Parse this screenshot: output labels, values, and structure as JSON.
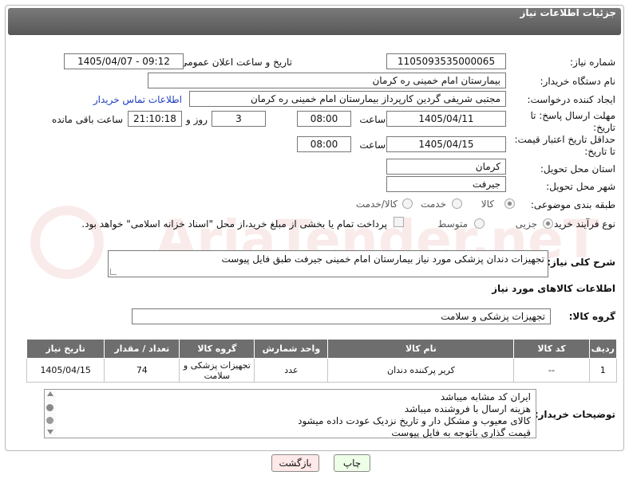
{
  "header": {
    "title": "جزئیات اطلاعات نیاز"
  },
  "form": {
    "need_number_label": "شماره نیاز:",
    "need_number": "1105093535000065",
    "announce_label": "تاریخ و ساعت اعلان عمومی:",
    "announce_value": "1405/04/07 - 09:12",
    "buyer_org_label": "نام دستگاه خریدار:",
    "buyer_org": "بیمارستان امام خمینی  ره  کرمان",
    "creator_label": "ایجاد کننده درخواست:",
    "creator": "مجتبی شریفی گردین کارپرداز بیمارستان امام خمینی  ره  کرمان",
    "contact_link": "اطلاعات تماس خریدار",
    "deadline_label_1": "مهلت ارسال پاسخ: تا",
    "deadline_label_2": "تاریخ:",
    "deadline_date": "1405/04/11",
    "time_label": "ساعت",
    "deadline_time": "08:00",
    "days_value": "3",
    "days_label": "روز و",
    "remaining_time": "21:10:18",
    "remaining_label": "ساعت باقی مانده",
    "validity_label_1": "حداقل تاریخ اعتبار قیمت:",
    "validity_label_2": "تا تاریخ:",
    "validity_date": "1405/04/15",
    "validity_time": "08:00",
    "province_label": "استان محل تحویل:",
    "province": "کرمان",
    "city_label": "شهر محل تحویل:",
    "city": "جیرفت",
    "category_label": "طبقه بندی موضوعی:",
    "category_options": [
      "کالا",
      "خدمت",
      "کالا/خدمت"
    ],
    "process_label": "نوع فرآیند خرید :",
    "process_options": [
      "جزیی",
      "متوسط"
    ],
    "payment_note": "پرداخت تمام یا بخشی از مبلغ خرید،از محل \"اسناد خزانه اسلامی\" خواهد بود.",
    "description_label": "شرح کلی نیاز:",
    "description": "تجهیزات دندان پزشکی مورد نیاز بیمارستان  امام خمینی جیرفت طبق فایل پیوست"
  },
  "goods": {
    "section_title": "اطلاعات کالاهای مورد نیاز",
    "group_label": "گروه کالا:",
    "group_value": "تجهیزات پزشکی و سلامت",
    "columns": [
      "ردیف",
      "کد کالا",
      "نام کالا",
      "واحد شمارش",
      "گروه کالا",
      "تعداد / مقدار",
      "تاریخ نیاز"
    ],
    "rows": [
      {
        "row": "1",
        "code": "--",
        "name": "کریر پرکننده دندان",
        "unit": "عدد",
        "group_line1": "تجهیزات پزشکی و",
        "group_line2": "سلامت",
        "qty": "74",
        "date": "1405/04/15"
      }
    ]
  },
  "notes": {
    "label": "توضیحات خریدار:",
    "lines": [
      "ایران کد مشابه میباشد",
      "هزینه ارسال با فروشنده میباشد",
      "کالای معیوب و مشکل دار و تاریخ نزدیک عودت داده میشود",
      "قیمت گذاری باتوجه به فایل پیوست"
    ]
  },
  "buttons": {
    "print": "چاپ",
    "back": "بازگشت"
  },
  "watermark": "AriaTender.neT",
  "colors": {
    "header": "#666666",
    "link": "#1f3fbf",
    "print_btn": "#eeffe8",
    "back_btn": "#ffe8e8"
  }
}
